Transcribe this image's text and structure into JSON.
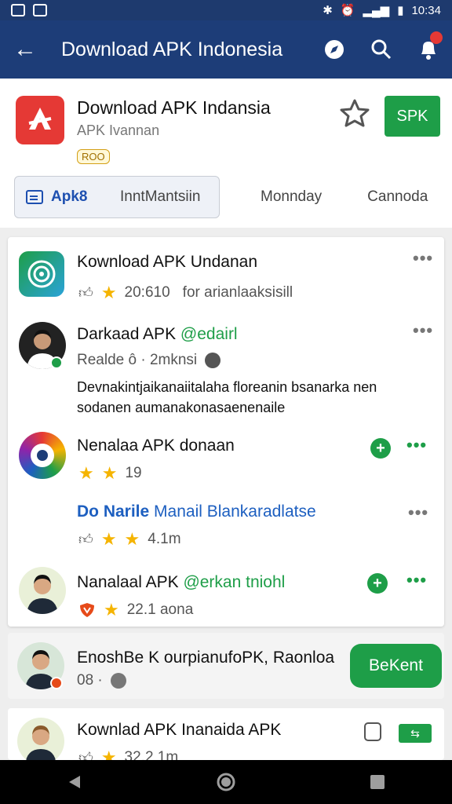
{
  "status_bar": {
    "time": "10:34"
  },
  "app_bar": {
    "title": "Download APK Indonesia"
  },
  "header": {
    "app_name": "Download APK Indansia",
    "subtitle": "APK Ivannan",
    "rating_badge": "ROO",
    "install_label": "SPK"
  },
  "tabs": [
    {
      "label": "Apk8",
      "sub": "InntMantsiin"
    },
    {
      "label": "Monnday"
    },
    {
      "label": "Cannoda"
    }
  ],
  "list": [
    {
      "name": "Kownload APK Undanan",
      "meta": "20:610",
      "meta2": "for arianlaaksisill"
    },
    {
      "name": "Darkaad APK",
      "handle": "@edairl",
      "meta": "Realde ô · 2mknsi",
      "body": "Devnakintjaikanaiitalaha floreanin bsanarka nen sodanen aumanakonasaenenaile"
    },
    {
      "name": "Nenalaa APK donaan",
      "meta": "19"
    },
    {
      "name": "Do Narile",
      "name2": "Manail Blankaradlatse",
      "meta": "4.1m"
    },
    {
      "name": "Nanalaal APK",
      "handle": "@erkan tniohl",
      "meta": "22.1 aona"
    }
  ],
  "feature_row": {
    "name": "EnoshBe K ourpianufoPK, Raonloa",
    "meta": "08 ·",
    "button": "BeKent"
  },
  "bottom_row": {
    "name": "Kownlad APK Inanaida APK",
    "meta": "32.2 1m"
  }
}
